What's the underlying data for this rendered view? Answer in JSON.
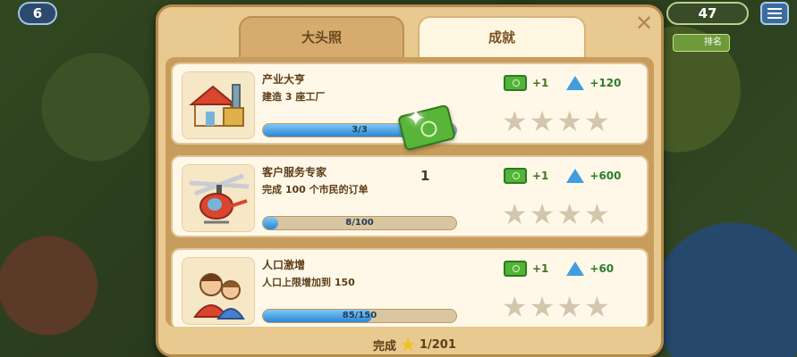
{
  "hud": {
    "level": "6",
    "currency": "47",
    "small_button": "排名"
  },
  "tabs": {
    "profile": "大头照",
    "achievements": "成就"
  },
  "achievements": [
    {
      "title": "产业大亨",
      "desc": "建造 3 座工厂",
      "progress": "3/3",
      "progress_fraction": 1.0,
      "cash": "+1",
      "xp": "+120",
      "stars_filled": 0,
      "icon": "factory-icon"
    },
    {
      "title": "客户服务专家",
      "desc": "完成 100 个市民的订单",
      "progress": "8/100",
      "progress_fraction": 0.08,
      "cash": "+1",
      "xp": "+600",
      "stars_filled": 0,
      "icon": "helicopter-icon"
    },
    {
      "title": "人口激增",
      "desc": "人口上限增加到 150",
      "progress": "85/150",
      "progress_fraction": 0.567,
      "cash": "+1",
      "xp": "+60",
      "stars_filled": 0,
      "icon": "people-icon"
    }
  ],
  "claim_count": "1",
  "footer": {
    "label": "完成",
    "count": "1/201"
  },
  "colors": {
    "panel": "#e8c98f",
    "progress": "#2d86d2",
    "cash": "#52b43a",
    "xp": "#3f9de0",
    "star": "#f2c21b"
  }
}
